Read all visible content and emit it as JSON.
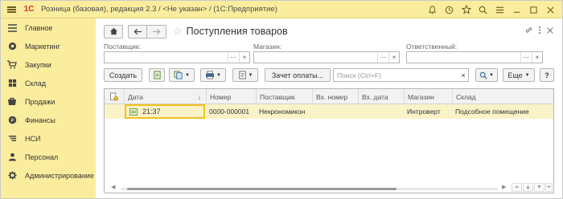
{
  "window": {
    "title": "Розница (базовая), редакция 2.3 / <Не указан> /  (1С:Предприятие)",
    "logo": "1С",
    "icons": [
      "bell-icon",
      "history-icon",
      "star-icon",
      "search-icon",
      "menu-icon",
      "minimize-icon",
      "maximize-icon",
      "close-icon"
    ]
  },
  "sidebar": {
    "items": [
      {
        "label": "Главное",
        "icon": "menu-icon"
      },
      {
        "label": "Маркетинг",
        "icon": "marketing-icon"
      },
      {
        "label": "Закупки",
        "icon": "cart-icon"
      },
      {
        "label": "Склад",
        "icon": "warehouse-icon"
      },
      {
        "label": "Продажи",
        "icon": "sales-icon"
      },
      {
        "label": "Финансы",
        "icon": "finance-icon"
      },
      {
        "label": "НСИ",
        "icon": "reference-icon"
      },
      {
        "label": "Персонал",
        "icon": "person-icon"
      },
      {
        "label": "Администрирование",
        "icon": "gear-icon"
      }
    ]
  },
  "page": {
    "title": "Поступления товаров"
  },
  "filters": {
    "supplier_label": "Поставщик:",
    "store_label": "Магазин:",
    "responsible_label": "Ответственный:",
    "supplier_value": "",
    "store_value": "",
    "responsible_value": ""
  },
  "toolbar": {
    "create_label": "Создать",
    "payment_label": "Зачет оплаты...",
    "search_placeholder": "Поиск (Ctrl+F)",
    "more_label": "Еще",
    "help_label": "?"
  },
  "table": {
    "columns": [
      "Дата",
      "Номер",
      "Поставщик",
      "Вх. номер",
      "Вх. дата",
      "Магазин",
      "Склад"
    ],
    "sort_indicator": "↓",
    "rows": [
      {
        "date": "21:37",
        "number": "0000-000001",
        "supplier": "Некрономикон",
        "in_number": "",
        "in_date": "",
        "store": "Интроверт",
        "warehouse": "Подсобное помещение"
      }
    ]
  },
  "colors": {
    "accent_panel": "#fbed9e",
    "selected_row": "#fbf3c8",
    "selected_border": "#f0c020"
  }
}
